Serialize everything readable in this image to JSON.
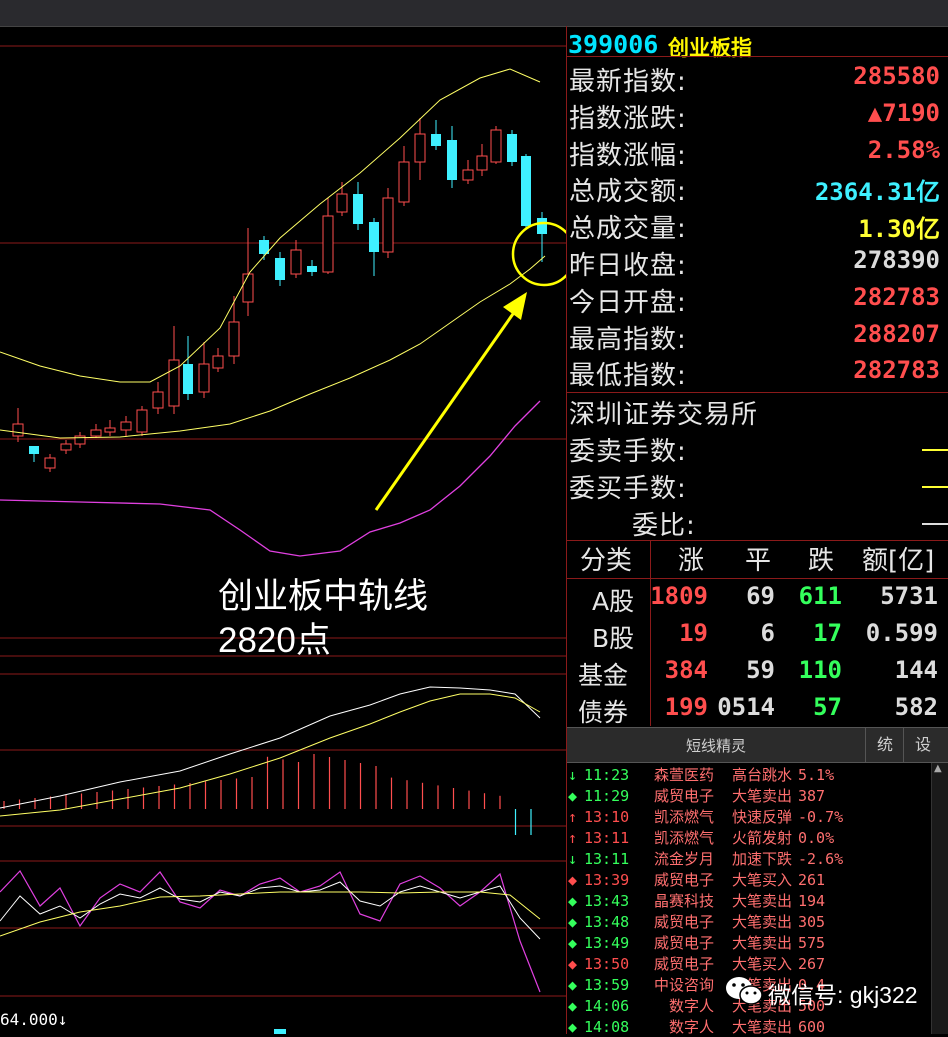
{
  "header": {
    "code": "399006",
    "name": "创业板指"
  },
  "quote": [
    {
      "label": "最新指数:",
      "value": "285580",
      "color": "red"
    },
    {
      "label": "指数涨跌:",
      "value": "▲7190",
      "color": "red"
    },
    {
      "label": "指数涨幅:",
      "value": "2.58%",
      "color": "red"
    },
    {
      "label": "总成交额:",
      "value": "2364.31亿",
      "color": "cyan"
    },
    {
      "label": "总成交量:",
      "value": "1.30亿",
      "color": "yellow"
    },
    {
      "label": "昨日收盘:",
      "value": "278390",
      "color": "white"
    },
    {
      "label": "今日开盘:",
      "value": "282783",
      "color": "red"
    },
    {
      "label": "最高指数:",
      "value": "288207",
      "color": "red"
    },
    {
      "label": "最低指数:",
      "value": "282783",
      "color": "red"
    }
  ],
  "exchange": "深圳证券交易所",
  "orders": [
    {
      "label": "委卖手数:",
      "color": "#ffff33"
    },
    {
      "label": "委买手数:",
      "color": "#ffff33"
    },
    {
      "label": "委比:",
      "color": "#dddddd"
    }
  ],
  "breadth": {
    "headers": [
      "分类",
      "涨",
      "平",
      "跌",
      "额[亿]"
    ],
    "rows": [
      {
        "cat": "A股",
        "up": "1809",
        "flat": "69",
        "down": "611",
        "amt": "5731"
      },
      {
        "cat": "B股",
        "up": "19",
        "flat": "6",
        "down": "17",
        "amt": "0.599"
      },
      {
        "cat": "基金",
        "up": "384",
        "flat": "59",
        "down": "110",
        "amt": "144"
      },
      {
        "cat": "债券",
        "up": "199",
        "flat": "0514",
        "down": "57",
        "amt": "582"
      }
    ]
  },
  "sprite": {
    "title": "短线精灵",
    "btn_stats": "统",
    "btn_settings": "设",
    "alerts": [
      {
        "arrow": "↓",
        "color": "#34ff5c",
        "time": "11:23",
        "stock": "森萱医药",
        "event": "高台跳水",
        "val": "5.1%"
      },
      {
        "arrow": "◆",
        "color": "#34ff5c",
        "time": "11:29",
        "stock": "威贸电子",
        "event": "大笔卖出",
        "val": "387"
      },
      {
        "arrow": "↑",
        "color": "#ff4e4e",
        "time": "13:10",
        "stock": "凯添燃气",
        "event": "快速反弹",
        "val": "-0.7%"
      },
      {
        "arrow": "↑",
        "color": "#ff4e4e",
        "time": "13:11",
        "stock": "凯添燃气",
        "event": "火箭发射",
        "val": "0.0%"
      },
      {
        "arrow": "↓",
        "color": "#34ff5c",
        "time": "13:11",
        "stock": "流金岁月",
        "event": "加速下跌",
        "val": "-2.6%"
      },
      {
        "arrow": "◆",
        "color": "#ff4e4e",
        "time": "13:39",
        "stock": "威贸电子",
        "event": "大笔买入",
        "val": "261"
      },
      {
        "arrow": "◆",
        "color": "#34ff5c",
        "time": "13:43",
        "stock": "晶赛科技",
        "event": "大笔卖出",
        "val": "194"
      },
      {
        "arrow": "◆",
        "color": "#34ff5c",
        "time": "13:48",
        "stock": "威贸电子",
        "event": "大笔卖出",
        "val": "305"
      },
      {
        "arrow": "◆",
        "color": "#34ff5c",
        "time": "13:49",
        "stock": "威贸电子",
        "event": "大笔卖出",
        "val": "575"
      },
      {
        "arrow": "◆",
        "color": "#ff4e4e",
        "time": "13:50",
        "stock": "威贸电子",
        "event": "大笔买入",
        "val": "267"
      },
      {
        "arrow": "◆",
        "color": "#34ff5c",
        "time": "13:59",
        "stock": "中设咨询",
        "event": "大笔卖出",
        "val": "0.4"
      },
      {
        "arrow": "◆",
        "color": "#34ff5c",
        "time": "14:06",
        "stock": "数字人",
        "event": "大笔卖出",
        "val": "500"
      },
      {
        "arrow": "◆",
        "color": "#34ff5c",
        "time": "14:08",
        "stock": "数字人",
        "event": "大笔卖出",
        "val": "600"
      }
    ]
  },
  "annotation": {
    "line1": "创业板中轨线",
    "line2": "2820点"
  },
  "watermark": "微信号: gkj322",
  "bottom_value": "64.000↓",
  "colors": {
    "up": "#ff4e4e",
    "down": "#3ff0ff",
    "grid": "#8b1a1a",
    "ma": "#ffff66",
    "boll_lower": "#e040e0",
    "highlight": "#ffff00"
  }
}
